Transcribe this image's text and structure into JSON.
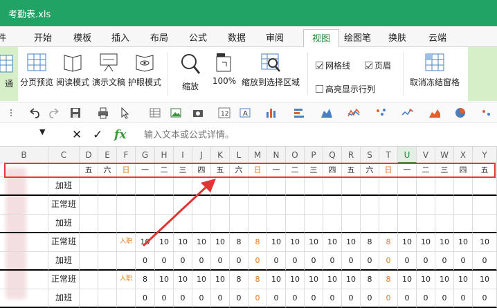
{
  "app": {
    "title": "考勤表.xls"
  },
  "menu": {
    "items": [
      "件",
      "开始",
      "模板",
      "插入",
      "布局",
      "公式",
      "数据",
      "审阅",
      "视图",
      "绘图笔",
      "换肤",
      "云端"
    ],
    "active_index": 8
  },
  "ribbon": {
    "buttons": [
      {
        "label": "通",
        "icon": "normal-view-icon"
      },
      {
        "label": "分页预览",
        "icon": "page-break-preview-icon"
      },
      {
        "label": "阅读模式",
        "icon": "reading-mode-icon"
      },
      {
        "label": "演示文稿",
        "icon": "presentation-icon"
      },
      {
        "label": "护眼模式",
        "icon": "eye-protection-icon"
      },
      {
        "label": "缩放",
        "icon": "zoom-icon"
      },
      {
        "label": "100%",
        "icon": "zoom-100-icon"
      },
      {
        "label": "缩放到选择区域",
        "icon": "zoom-to-selection-icon"
      },
      {
        "label": "取消冻结窗格",
        "icon": "unfreeze-panes-icon"
      }
    ],
    "checkboxes": [
      {
        "label": "网格线",
        "checked": true
      },
      {
        "label": "页眉",
        "checked": true
      },
      {
        "label": "高亮显示行列",
        "checked": false
      }
    ]
  },
  "formula": {
    "placeholder": "输入文本或公式详情。",
    "fx_label": "fx"
  },
  "sheet": {
    "selected_column": "U",
    "columns": [
      "B",
      "C",
      "D",
      "E",
      "F",
      "G",
      "H",
      "I",
      "J",
      "K",
      "L",
      "M",
      "N",
      "O",
      "P",
      "Q",
      "R",
      "S",
      "T",
      "U",
      "V",
      "W",
      "X",
      "Y"
    ],
    "weekday_row": [
      "",
      "",
      "五",
      "六",
      "日",
      "一",
      "二",
      "三",
      "四",
      "五",
      "六",
      "日",
      "一",
      "二",
      "三",
      "四",
      "五",
      "六",
      "日",
      "一",
      "二",
      "三",
      "四",
      "五"
    ],
    "rows": [
      [
        "",
        "加班",
        "",
        "",
        "",
        "",
        "",
        "",
        "",
        "",
        "",
        "",
        "",
        "",
        "",
        "",
        "",
        "",
        "",
        "",
        "",
        "",
        "",
        ""
      ],
      [
        "",
        "正常班",
        "",
        "",
        "",
        "",
        "",
        "",
        "",
        "",
        "",
        "",
        "",
        "",
        "",
        "",
        "",
        "",
        "",
        "",
        "",
        "",
        "",
        ""
      ],
      [
        "",
        "加班",
        "",
        "",
        "",
        "",
        "",
        "",
        "",
        "",
        "",
        "",
        "",
        "",
        "",
        "",
        "",
        "",
        "",
        "",
        "",
        "",
        "",
        ""
      ],
      [
        "",
        "正常班",
        "",
        "",
        "入职",
        "10",
        "10",
        "10",
        "10",
        "10",
        "8",
        "8",
        "10",
        "10",
        "10",
        "10",
        "10",
        "8",
        "8",
        "10",
        "10",
        "10",
        "10",
        "10"
      ],
      [
        "",
        "加班",
        "",
        "",
        "",
        "0",
        "0",
        "0",
        "0",
        "0",
        "0",
        "0",
        "0",
        "0",
        "0",
        "0",
        "0",
        "0",
        "0",
        "0",
        "0",
        "0",
        "0",
        "0"
      ],
      [
        "",
        "正常班",
        "",
        "",
        "入职",
        "8",
        "10",
        "10",
        "10",
        "10",
        "8",
        "8",
        "10",
        "10",
        "10",
        "10",
        "10",
        "8",
        "8",
        "10",
        "10",
        "10",
        "10",
        "10"
      ],
      [
        "",
        "加班",
        "",
        "",
        "",
        "0",
        "0",
        "0",
        "0",
        "0",
        "0",
        "0",
        "0",
        "0",
        "0",
        "0",
        "0",
        "0",
        "0",
        "0",
        "0",
        "0",
        "0",
        "0"
      ]
    ]
  },
  "colors": {
    "title_bar": "#21a366",
    "accent": "#1f8a3d",
    "annotation": "#e33333",
    "weekend": "#e07b21"
  }
}
